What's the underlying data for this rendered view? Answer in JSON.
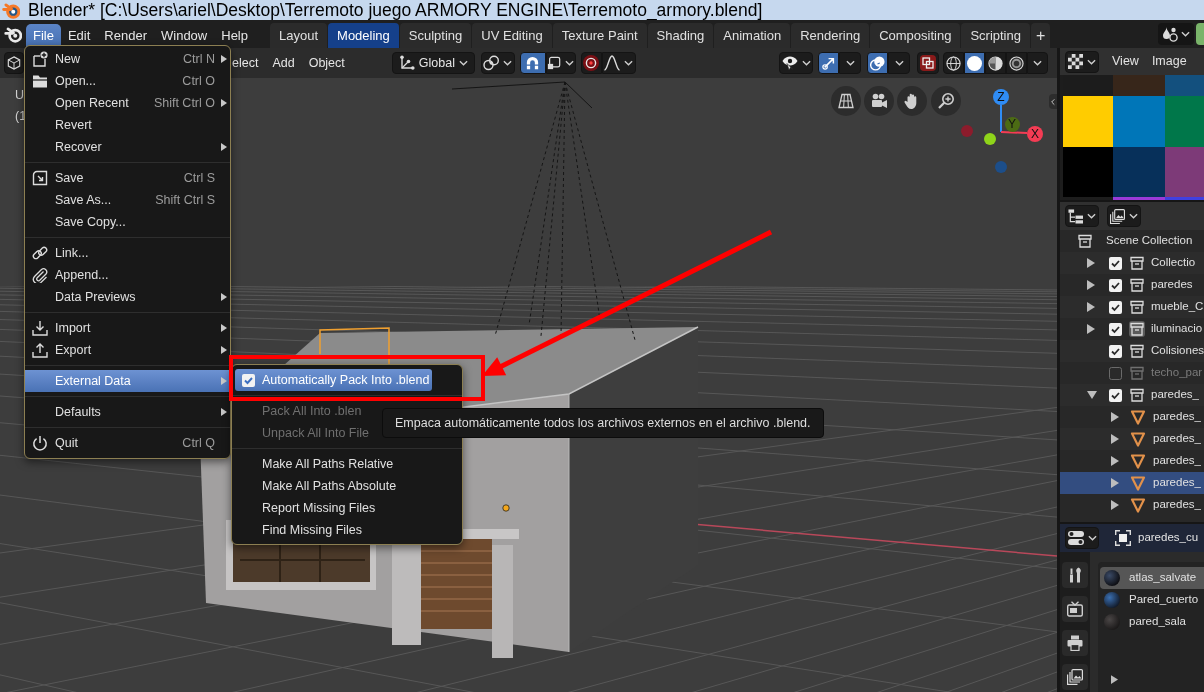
{
  "window": {
    "title": "Blender* [C:\\Users\\ariel\\Desktop\\Terremoto juego ARMORY ENGINE\\Terremoto_armory.blend]"
  },
  "menu_bar": [
    {
      "label": "File",
      "selected": true
    },
    {
      "label": "Edit",
      "selected": false
    },
    {
      "label": "Render",
      "selected": false
    },
    {
      "label": "Window",
      "selected": false
    },
    {
      "label": "Help",
      "selected": false
    }
  ],
  "workspace_tabs": [
    {
      "label": "Layout",
      "selected": false
    },
    {
      "label": "Modeling",
      "selected": true
    },
    {
      "label": "Sculpting",
      "selected": false
    },
    {
      "label": "UV Editing",
      "selected": false
    },
    {
      "label": "Texture Paint",
      "selected": false
    },
    {
      "label": "Shading",
      "selected": false
    },
    {
      "label": "Animation",
      "selected": false
    },
    {
      "label": "Rendering",
      "selected": false
    },
    {
      "label": "Compositing",
      "selected": false
    },
    {
      "label": "Scripting",
      "selected": false
    }
  ],
  "add_workspace": "+",
  "viewport": {
    "header": {
      "menus": [
        "elect",
        "Add",
        "Object"
      ],
      "orientation": "Global",
      "snap_on": true,
      "gizmos_on": true,
      "overlays_on": true,
      "shading_modes": [
        {
          "selected": false
        },
        {
          "selected": true
        },
        {
          "selected": false
        },
        {
          "selected": false
        }
      ]
    },
    "overlay_text": [
      "U",
      "(1"
    ],
    "axes": [
      {
        "label": "Z",
        "color": "#2f8cf5"
      },
      {
        "label": "Y",
        "color": "#4c6b14"
      },
      {
        "label": "X",
        "color": "#f43c54"
      }
    ],
    "negative_axes": [
      {
        "color": "#8c1c2c"
      },
      {
        "color": "#8fd41a"
      },
      {
        "color": "#1c4e8a"
      }
    ]
  },
  "file_menu": [
    [
      {
        "label": "New",
        "shortcut": "Ctrl N",
        "has_submenu": true,
        "selected": false
      },
      {
        "label": "Open...",
        "shortcut": "Ctrl O",
        "has_submenu": false,
        "selected": false
      },
      {
        "label": "Open Recent",
        "shortcut": "Shift Ctrl O",
        "has_submenu": true,
        "selected": false
      },
      {
        "label": "Revert",
        "has_submenu": false,
        "selected": false
      },
      {
        "label": "Recover",
        "has_submenu": true,
        "selected": false
      }
    ],
    [
      {
        "label": "Save",
        "shortcut": "Ctrl S",
        "has_submenu": false,
        "selected": false
      },
      {
        "label": "Save As...",
        "shortcut": "Shift Ctrl S",
        "has_submenu": false,
        "selected": false
      },
      {
        "label": "Save Copy...",
        "has_submenu": false,
        "selected": false
      }
    ],
    [
      {
        "label": "Link...",
        "has_submenu": false,
        "selected": false
      },
      {
        "label": "Append...",
        "has_submenu": false,
        "selected": false
      },
      {
        "label": "Data Previews",
        "has_submenu": true,
        "selected": false
      }
    ],
    [
      {
        "label": "Import",
        "has_submenu": true,
        "selected": false
      },
      {
        "label": "Export",
        "has_submenu": true,
        "selected": false
      }
    ],
    [
      {
        "label": "External Data",
        "has_submenu": true,
        "selected": true
      }
    ],
    [
      {
        "label": "Defaults",
        "has_submenu": true,
        "selected": false
      }
    ],
    [
      {
        "label": "Quit",
        "shortcut": "Ctrl Q",
        "has_submenu": false,
        "selected": false
      }
    ]
  ],
  "external_data_menu": [
    [
      {
        "label": "Automatically Pack Into .blend",
        "kind": "checkbox",
        "checked": true,
        "selected": true,
        "disabled": false
      }
    ],
    [
      {
        "label": "Pack All Into .blen",
        "kind": "action",
        "selected": false,
        "disabled": true
      },
      {
        "label": "Unpack All Into File",
        "kind": "action",
        "selected": false,
        "disabled": true
      }
    ],
    [
      {
        "label": "Make All Paths Relative",
        "kind": "action",
        "selected": false,
        "disabled": false
      },
      {
        "label": "Make All Paths Absolute",
        "kind": "action",
        "selected": false,
        "disabled": false
      },
      {
        "label": "Report Missing Files",
        "kind": "action",
        "selected": false,
        "disabled": false
      },
      {
        "label": "Find Missing Files",
        "kind": "action",
        "selected": false,
        "disabled": false
      }
    ]
  ],
  "tooltip": "Empaca automáticamente todos los archivos externos en el archivo .blend.",
  "image_editor": {
    "menus": [
      "View",
      "Image"
    ]
  },
  "outliner": {
    "root": {
      "label": "Scene Collection",
      "kind": "collection",
      "selected": false,
      "children": [
        {
          "label": "Collectio",
          "kind": "collection",
          "checked": true,
          "expanded": false,
          "active": false,
          "selected": false
        },
        {
          "label": "paredes",
          "kind": "collection",
          "checked": true,
          "expanded": false,
          "active": false,
          "selected": false
        },
        {
          "label": "mueble_C",
          "kind": "collection",
          "checked": true,
          "expanded": false,
          "active": false,
          "selected": false
        },
        {
          "label": "iluminacio",
          "kind": "collection",
          "checked": true,
          "expanded": false,
          "active": true,
          "selected": false
        },
        {
          "label": "Colisiones",
          "kind": "collection",
          "checked": true,
          "active": false,
          "selected": false
        },
        {
          "label": "techo_par",
          "kind": "collection",
          "checked": false,
          "active": false,
          "selected": false
        },
        {
          "label": "paredes_",
          "kind": "collection",
          "checked": true,
          "expanded": true,
          "active": false,
          "selected": false,
          "children": [
            {
              "label": "paredes_",
              "kind": "mesh",
              "expanded": false,
              "selected": false
            },
            {
              "label": "paredes_",
              "kind": "mesh",
              "expanded": false,
              "selected": false
            },
            {
              "label": "paredes_",
              "kind": "mesh",
              "expanded": false,
              "selected": false
            },
            {
              "label": "paredes_",
              "kind": "mesh",
              "expanded": false,
              "selected": true
            },
            {
              "label": "paredes_",
              "kind": "mesh",
              "expanded": false,
              "selected": false
            }
          ]
        }
      ]
    }
  },
  "properties": {
    "object_name": "paredes_cu",
    "material_slots": [
      {
        "name": "atlas_salvate",
        "selected": true
      },
      {
        "name": "Pared_cuerto",
        "selected": false
      },
      {
        "name": "pared_sala",
        "selected": false
      }
    ]
  }
}
